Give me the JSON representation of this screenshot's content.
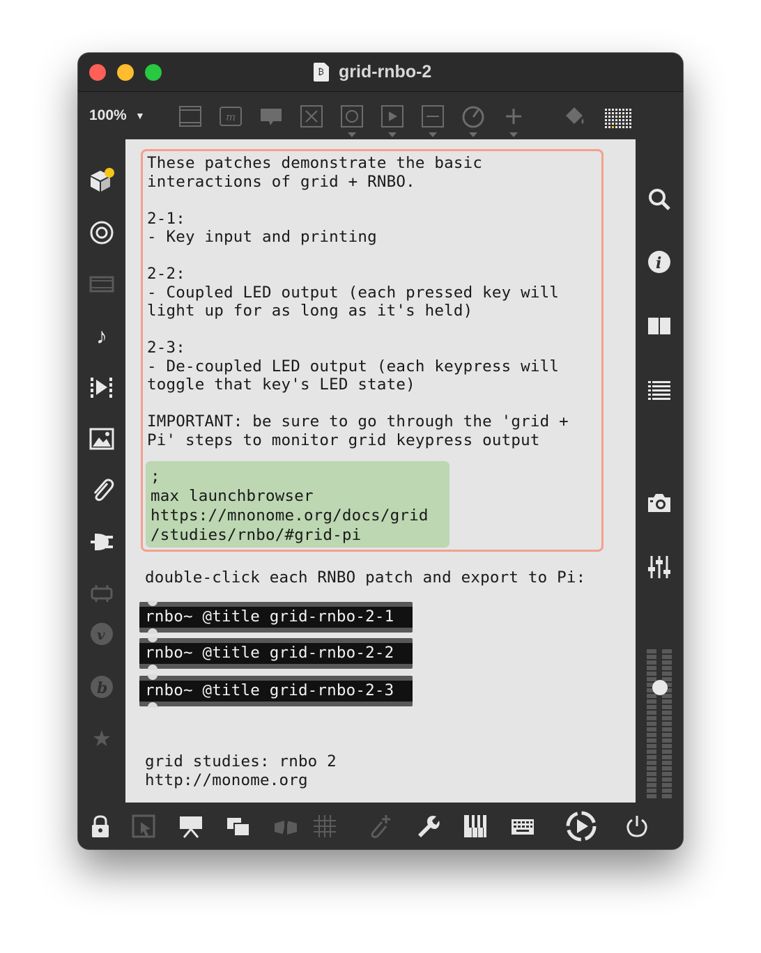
{
  "window": {
    "title": "grid-rnbo-2"
  },
  "toolbar": {
    "zoom": "100%"
  },
  "patch": {
    "comment_lines": "These patches demonstrate the basic\ninteractions of grid + RNBO.\n\n2-1:\n- Key input and printing\n\n2-2:\n- Coupled LED output (each pressed key will\nlight up for as long as it's held)\n\n2-3:\n- De-coupled LED output (each keypress will\ntoggle that key's LED state)\n\nIMPORTANT: be sure to go through the 'grid +\nPi' steps to monitor grid keypress output",
    "message_box": ";\nmax launchbrowser\nhttps://mnonome.org/docs/grid\n/studies/rnbo/#grid-pi",
    "instruction": "double-click each RNBO patch and export to Pi:",
    "rnbo_objects": [
      "rnbo~ @title grid-rnbo-2-1",
      "rnbo~ @title grid-rnbo-2-2",
      "rnbo~ @title grid-rnbo-2-3"
    ],
    "footer": "grid studies: rnbo 2\nhttp://monome.org"
  },
  "colors": {
    "comment_border": "#f4a08e",
    "message_fill": "#bcd7b2",
    "canvas": "#e5e5e5",
    "chrome": "#2f2f2f"
  }
}
